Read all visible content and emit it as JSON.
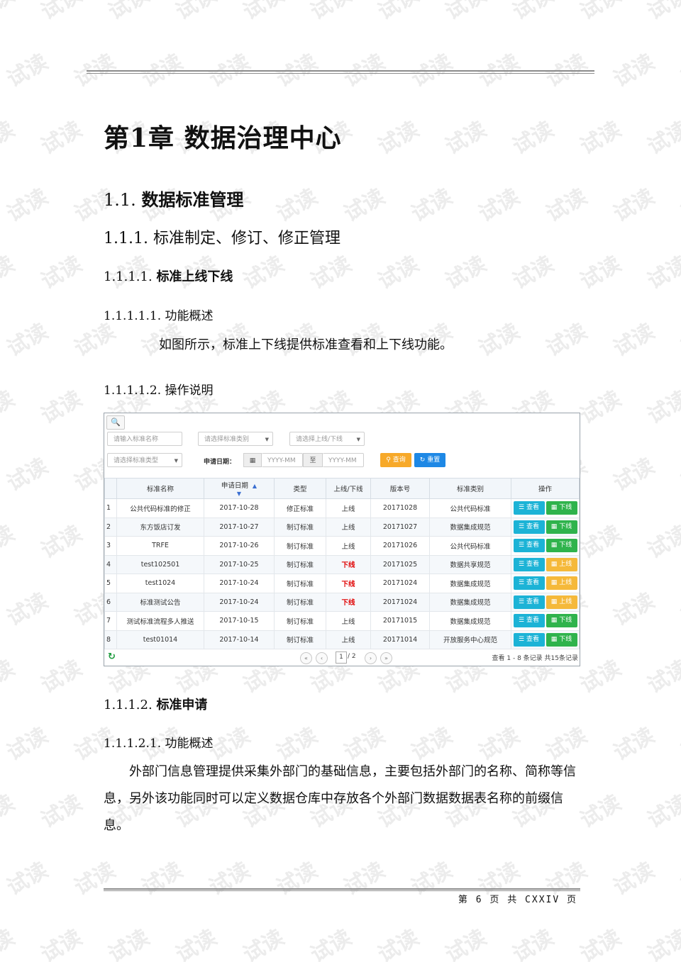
{
  "watermark": "试读",
  "chapter_title": "第1章  数据治理中心",
  "section": {
    "num": "1.1.",
    "title": "数据标准管理"
  },
  "subsection": {
    "num": "1.1.1.",
    "title": "标准制定、修订、修正管理"
  },
  "subsub1": {
    "num": "1.1.1.1.",
    "title": "标准上线下线"
  },
  "h5_overview1": "1.1.1.1.1. 功能概述",
  "para1": "如图所示，标准上下线提供标准查看和上下线功能。",
  "h5_ops": "1.1.1.1.2. 操作说明",
  "screenshot": {
    "search_icon": "search-icon",
    "name_placeholder": "请输入标准名称",
    "category_placeholder": "请选择标准类别",
    "online_placeholder": "请选择上线/下线",
    "type_placeholder": "请选择标准类型",
    "date_label": "申请日期：",
    "date_from": "YYYY-MM",
    "date_to_sep": "至",
    "date_to": "YYYY-MM",
    "query_btn": "查询",
    "reset_btn": "重置",
    "columns": [
      "标准名称",
      "申请日期",
      "类型",
      "上线/下线",
      "版本号",
      "标准类别",
      "操作"
    ],
    "rows": [
      {
        "n": "1",
        "name": "公共代码标准的修正",
        "date": "2017-10-28",
        "type": "修正标准",
        "status": "上线",
        "ver": "20171028",
        "cat": "公共代码标准",
        "action": "下线"
      },
      {
        "n": "2",
        "name": "东方饭店订发",
        "date": "2017-10-27",
        "type": "制订标准",
        "status": "上线",
        "ver": "20171027",
        "cat": "数据集成规范",
        "action": "下线"
      },
      {
        "n": "3",
        "name": "TRFE",
        "date": "2017-10-26",
        "type": "制订标准",
        "status": "上线",
        "ver": "20171026",
        "cat": "公共代码标准",
        "action": "下线"
      },
      {
        "n": "4",
        "name": "test102501",
        "date": "2017-10-25",
        "type": "制订标准",
        "status": "下线",
        "ver": "20171025",
        "cat": "数据共享规范",
        "action": "上线"
      },
      {
        "n": "5",
        "name": "test1024",
        "date": "2017-10-24",
        "type": "制订标准",
        "status": "下线",
        "ver": "20171024",
        "cat": "数据集成规范",
        "action": "上线"
      },
      {
        "n": "6",
        "name": "标准测试公告",
        "date": "2017-10-24",
        "type": "制订标准",
        "status": "下线",
        "ver": "20171024",
        "cat": "数据集成规范",
        "action": "上线"
      },
      {
        "n": "7",
        "name": "测试标准流程多人推送",
        "date": "2017-10-15",
        "type": "制订标准",
        "status": "上线",
        "ver": "20171015",
        "cat": "数据集成规范",
        "action": "下线"
      },
      {
        "n": "8",
        "name": "test01014",
        "date": "2017-10-14",
        "type": "制订标准",
        "status": "上线",
        "ver": "20171014",
        "cat": "开放服务中心规范",
        "action": "下线"
      }
    ],
    "view_label": "查看",
    "pager": {
      "page": "1",
      "total": "/ 2",
      "info": "查看 1 - 8 条记录    共15条记录"
    }
  },
  "subsub2": {
    "num": "1.1.1.2.",
    "title": "标准申请"
  },
  "h5_overview2": "1.1.1.2.1. 功能概述",
  "para2": "外部门信息管理提供采集外部门的基础信息，主要包括外部门的名称、简称等信息，另外该功能同时可以定义数据仓库中存放各个外部门数据数据表名称的前缀信息。",
  "footer": "第 6 页  共 CXXIV 页"
}
